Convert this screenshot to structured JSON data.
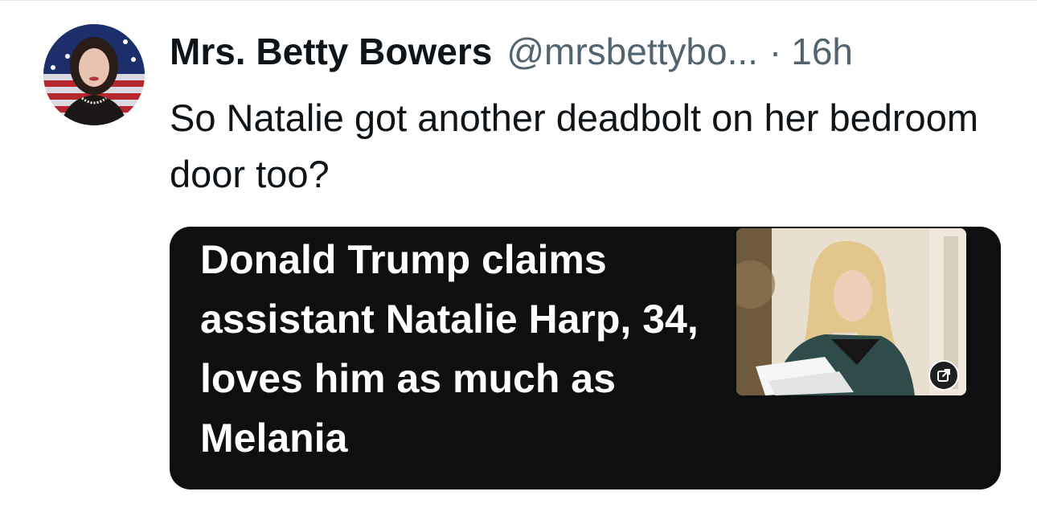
{
  "tweet": {
    "author": {
      "display_name": "Mrs. Betty Bowers",
      "handle": "@mrsbettybo...",
      "avatar_icon": "profile-avatar"
    },
    "separator": "·",
    "timestamp": "16h",
    "text": "So Natalie got another deadbolt on her bedroom door too?"
  },
  "link_card": {
    "headline": "Donald Trump claims assistant Natalie Harp, 34, loves him as much as Melania",
    "thumbnail_icon": "news-photo",
    "open_icon": "external-link-icon"
  },
  "colors": {
    "text_primary": "#0f1419",
    "text_secondary": "#536471",
    "card_background": "#0d0f10",
    "card_text": "#ffffff"
  }
}
